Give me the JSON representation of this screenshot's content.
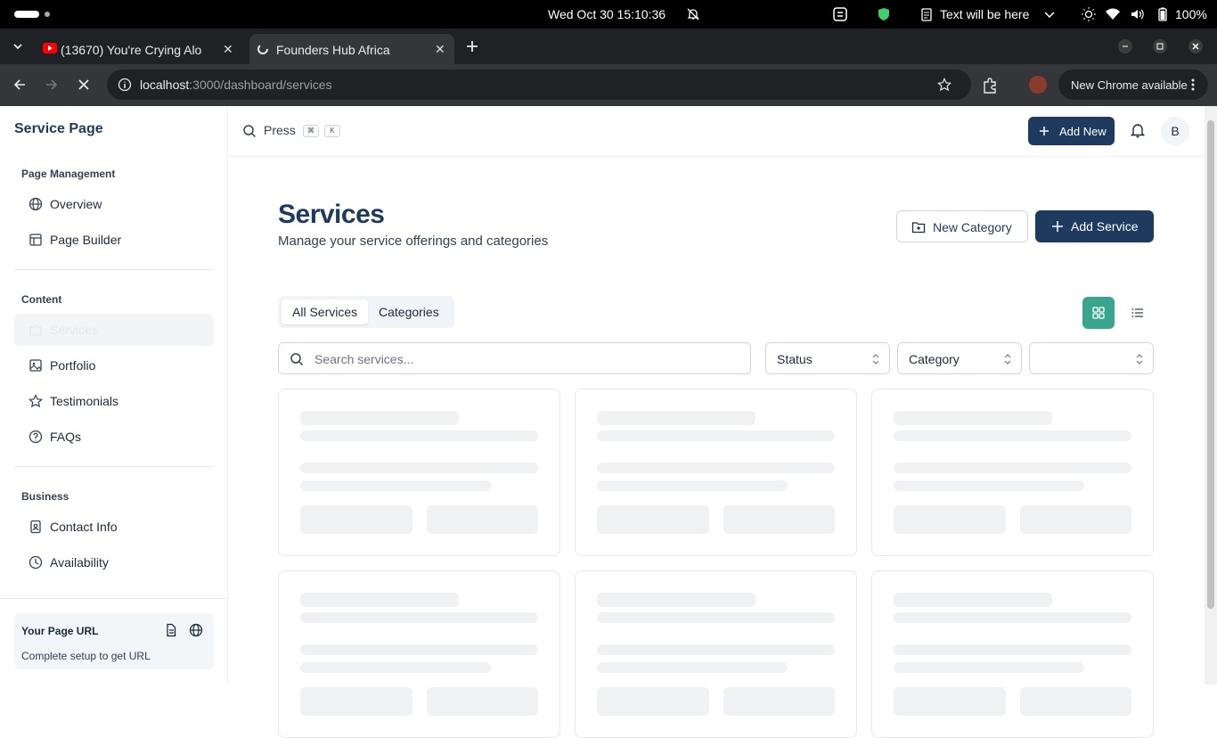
{
  "system": {
    "datetime": "Wed Oct 30  15:10:36",
    "indicator_text": "Text will be here",
    "battery": "100%"
  },
  "browser": {
    "tabs": [
      {
        "title": "(13670) You're Crying Alo",
        "active": false
      },
      {
        "title": "Founders Hub Africa",
        "active": true
      }
    ],
    "url_host": "localhost",
    "url_path": ":3000/dashboard/services",
    "update_label": "New Chrome available"
  },
  "sidebar": {
    "brand": "Service Page",
    "sections": [
      {
        "title": "Page Management",
        "items": [
          "Overview",
          "Page Builder"
        ]
      },
      {
        "title": "Content",
        "items": [
          "Services",
          "Portfolio",
          "Testimonials",
          "FAQs"
        ]
      },
      {
        "title": "Business",
        "items": [
          "Contact Info",
          "Availability"
        ]
      }
    ],
    "active_item": "Services",
    "url_box": {
      "title": "Your Page URL",
      "subtitle": "Complete setup to get URL"
    }
  },
  "topbar": {
    "search_label": "Press",
    "kbd1": "⌘",
    "kbd2": "K",
    "add_new": "Add New",
    "avatar_initial": "B"
  },
  "page": {
    "title": "Services",
    "subtitle": "Manage your service offerings and categories",
    "new_category": "New Category",
    "add_service": "Add Service",
    "tabs": [
      "All Services",
      "Categories"
    ],
    "active_tab": "All Services",
    "search_placeholder": "Search services...",
    "filters": [
      "Status",
      "Category",
      ""
    ],
    "view_mode": "grid"
  },
  "colors": {
    "brand_navy": "#1e3a5f",
    "accent_teal": "#3aa58f"
  }
}
